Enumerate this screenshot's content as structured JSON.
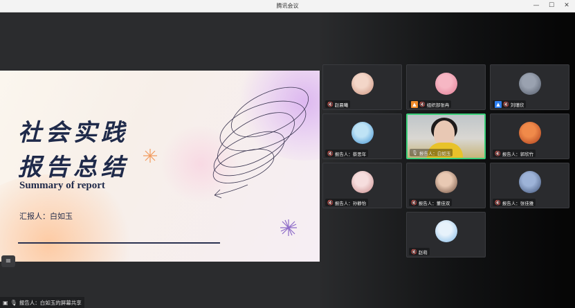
{
  "window": {
    "title": "腾讯会议",
    "controls": {
      "minimize": "—",
      "maximize": "☐",
      "close": "✕"
    }
  },
  "slide": {
    "title_line1": "社会实践",
    "title_line2": "报告总结",
    "subtitle": "Summary of report",
    "reporter": "汇报人：白如玉"
  },
  "share_bar": {
    "list_icon": "≡",
    "screen_icon": "▣",
    "mic_icon": "🎙",
    "text": "报告人：白如玉的屏幕共享"
  },
  "participants": [
    {
      "name": "赵晨曦",
      "avatar_colors": [
        "#f3d6c8",
        "#c98f7a"
      ],
      "icon": "mic-off-icon"
    },
    {
      "name": "组织部张冉",
      "badge": "host-badge",
      "badge_color": "#f08c2a",
      "avatar_colors": [
        "#f6b7c4",
        "#e27a93"
      ],
      "icon": "mic-off-icon"
    },
    {
      "name": "刘瑾欣",
      "badge": "cohost-badge",
      "badge_color": "#2d7ff0",
      "avatar_colors": [
        "#9aa2b0",
        "#4e5665"
      ],
      "icon": "mic-off-icon"
    },
    {
      "name": "报告人：蔡思年",
      "avatar_colors": [
        "#bfe3f5",
        "#3d8fd1"
      ],
      "icon": "mic-off-icon"
    },
    {
      "name": "报告人：白如玉",
      "video": true,
      "icon": "mic-on-icon",
      "active": true
    },
    {
      "name": "报告人：郭欣竹",
      "avatar_colors": [
        "#f08a4a",
        "#a83a1a"
      ],
      "icon": "mic-off-icon"
    },
    {
      "name": "报告人：孙静怡",
      "avatar_colors": [
        "#f6dede",
        "#c98a8a"
      ],
      "icon": "mic-off-icon"
    },
    {
      "name": "报告人：董佳双",
      "avatar_colors": [
        "#e8c9b3",
        "#6b4a3a"
      ],
      "icon": "mic-off-icon"
    },
    {
      "name": "报告人：张佳雅",
      "avatar_colors": [
        "#9db3d8",
        "#3c4f74"
      ],
      "icon": "mic-off-icon"
    },
    {
      "name": "赵萌",
      "avatar_colors": [
        "#e7f2fb",
        "#7fb8e6"
      ],
      "icon": "mic-off-icon"
    }
  ]
}
